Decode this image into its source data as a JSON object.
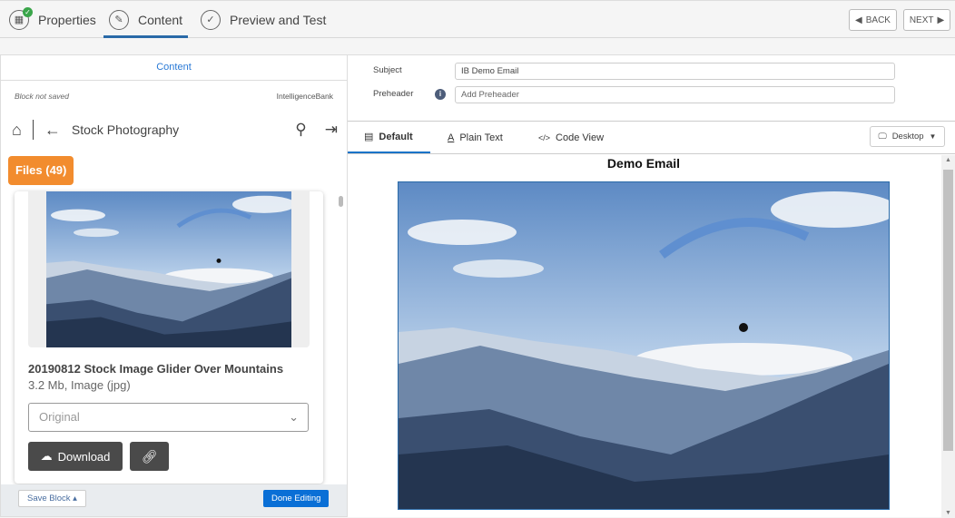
{
  "steps": [
    {
      "label": "Properties",
      "icon": "layout-icon",
      "completed": true
    },
    {
      "label": "Content",
      "icon": "pencil-icon",
      "active": true
    },
    {
      "label": "Preview and Test",
      "icon": "check-icon"
    }
  ],
  "nav": {
    "back": "BACK",
    "next": "NEXT"
  },
  "left": {
    "header": "Content",
    "status": "Block not saved",
    "brand": "IntelligenceBank",
    "folder": "Stock Photography",
    "files_badge": "Files (49)",
    "file": {
      "title": "20190812 Stock Image Glider Over Mountains",
      "meta": "3.2 Mb, Image (jpg)",
      "size_option": "Original",
      "download": "Download"
    },
    "save_block": "Save Block",
    "done_editing": "Done Editing"
  },
  "right": {
    "subject_label": "Subject",
    "subject_value": "IB Demo Email",
    "preheader_label": "Preheader",
    "preheader_placeholder": "Add Preheader",
    "tabs": [
      "Default",
      "Plain Text",
      "Code View"
    ],
    "device": "Desktop",
    "email_title": "Demo Email"
  },
  "colors": {
    "accent": "#2a6aa8",
    "files_badge": "#f28c2e",
    "done": "#0a6fd6"
  }
}
